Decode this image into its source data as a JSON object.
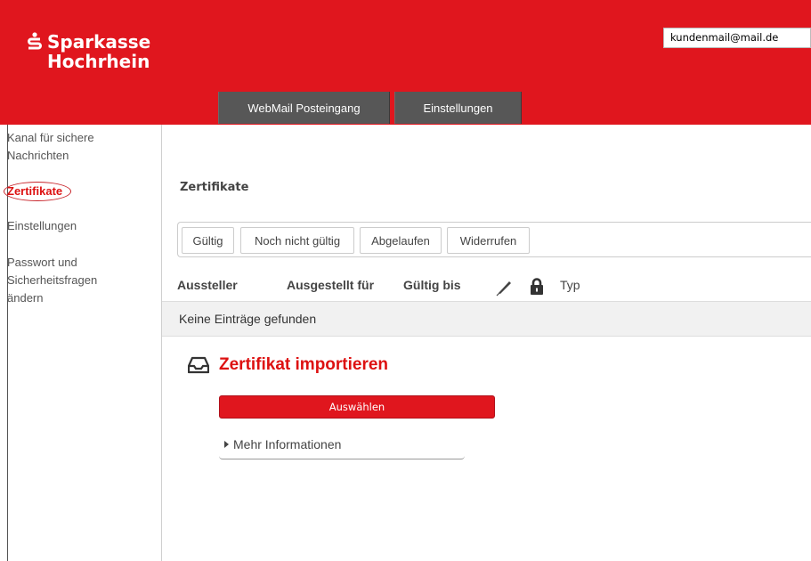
{
  "brand": {
    "line1": "Sparkasse",
    "line2": "Hochrhein",
    "color": "#e0161e"
  },
  "header": {
    "email": "kundenmail@mail.de"
  },
  "tabs": [
    {
      "label": "WebMail Posteingang"
    },
    {
      "label": "Einstellungen"
    }
  ],
  "sidebar": {
    "items": [
      {
        "label_line1": "Kanal für sichere",
        "label_line2": "Nachrichten"
      },
      {
        "label": "Zertifikate",
        "active": true
      },
      {
        "label": "Einstellungen"
      },
      {
        "label_line1": "Passwort und",
        "label_line2": "Sicherheitsfragen",
        "label_line3": "ändern"
      }
    ]
  },
  "main": {
    "title": "Zertifikate",
    "filters": [
      "Gültig",
      "Noch nicht gültig",
      "Abgelaufen",
      "Widerrufen"
    ],
    "columns": {
      "issuer": "Aussteller",
      "issued_to": "Ausgestellt für",
      "valid_until": "Gültig bis",
      "signature_icon": "pen-icon",
      "encryption_icon": "lock-icon",
      "type": "Typ"
    },
    "empty_message": "Keine Einträge gefunden",
    "import": {
      "icon": "inbox-icon",
      "title": "Zertifikat importieren",
      "select_button": "Auswählen",
      "more_info": "Mehr Informationen"
    }
  }
}
